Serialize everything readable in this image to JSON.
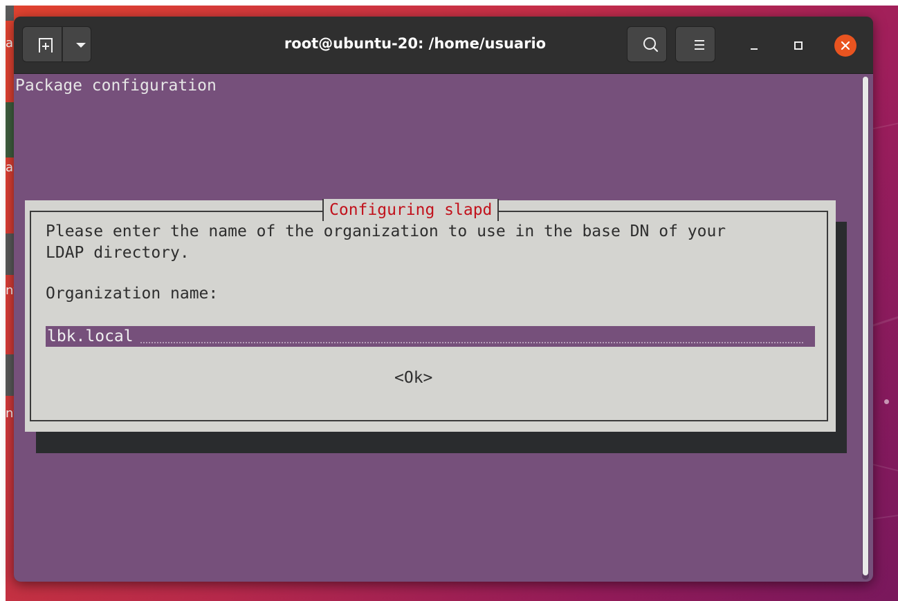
{
  "window": {
    "title": "root@ubuntu-20: /home/usuario"
  },
  "titlebar": {
    "icons": {
      "new_tab": "new-tab-icon",
      "dropdown": "chevron-down-icon",
      "search": "search-icon",
      "menu": "hamburger-icon",
      "minimize": "minimize-icon",
      "maximize": "maximize-icon",
      "close": "close-icon"
    },
    "close_color": "#e95420"
  },
  "terminal": {
    "header": "Package configuration",
    "background": "#76507b"
  },
  "dialog": {
    "title": "Configuring slapd",
    "prompt_line1": "Please enter the name of the organization to use in the base DN of your",
    "prompt_line2": "LDAP directory.",
    "field_label": "Organization name:",
    "field_value": "lbk.local",
    "ok_label": "<Ok>",
    "title_color": "#c1121c"
  },
  "desktop": {
    "left_letters": [
      "a",
      "a",
      "nt",
      "nt"
    ]
  }
}
